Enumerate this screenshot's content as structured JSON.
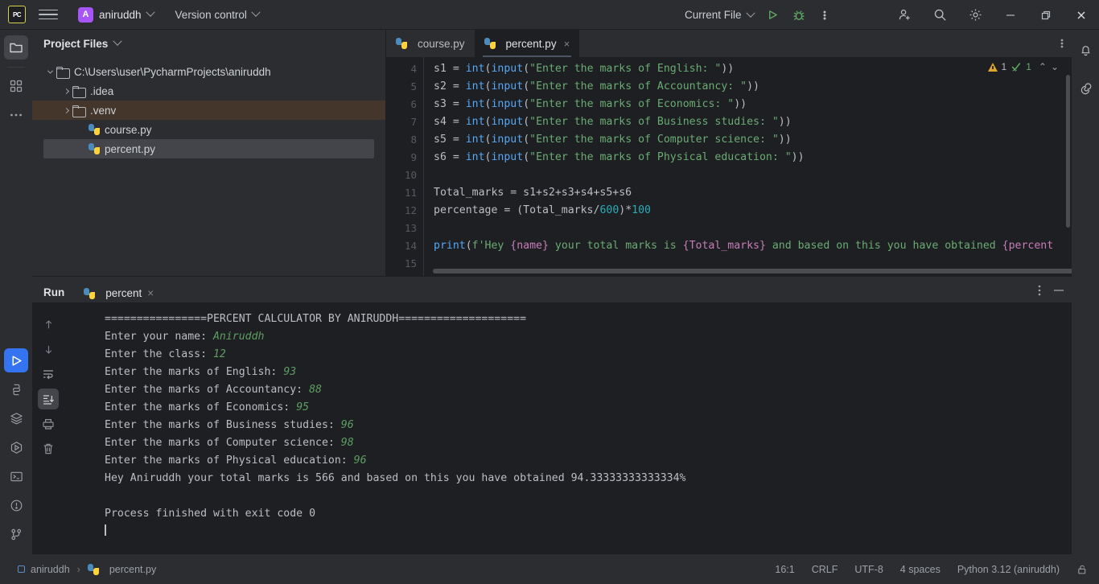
{
  "topbar": {
    "logo": "PC",
    "menu_icon": "hamburger-menu-icon",
    "project_initial": "A",
    "project_name": "aniruddh",
    "version_control": "Version control",
    "run_config": "Current File",
    "run_icon": "run-icon",
    "debug_icon": "debug-icon",
    "more_icon": "more-options-icon",
    "account_icon": "add-user-icon",
    "search_icon": "search-icon",
    "settings_icon": "gear-icon",
    "minimize": "minimize-icon",
    "maximize": "restore-icon",
    "close": "close-icon"
  },
  "left_rail": {
    "items": [
      {
        "name": "project-files-icon",
        "active": true
      },
      {
        "name": "structure-icon",
        "active": false
      },
      {
        "name": "more-tool-windows-icon",
        "active": false
      }
    ],
    "bottom_items": [
      {
        "name": "run-tool-icon",
        "active": true
      },
      {
        "name": "python-packages-icon",
        "active": false
      },
      {
        "name": "database-icon",
        "active": false
      },
      {
        "name": "services-icon",
        "active": false
      },
      {
        "name": "terminal-icon",
        "active": false
      },
      {
        "name": "problems-icon",
        "active": false
      },
      {
        "name": "version-control-icon",
        "active": false
      }
    ]
  },
  "project_panel": {
    "title": "Project Files",
    "tree": [
      {
        "label": "C:\\Users\\user\\PycharmProjects\\aniruddh",
        "type": "folder",
        "indent": 0,
        "expanded": true,
        "state": "none"
      },
      {
        "label": ".idea",
        "type": "folder",
        "indent": 1,
        "expanded": false,
        "state": "none"
      },
      {
        "label": ".venv",
        "type": "folder",
        "indent": 1,
        "expanded": false,
        "state": "orange"
      },
      {
        "label": "course.py",
        "type": "python",
        "indent": 2,
        "expanded": null,
        "state": "none"
      },
      {
        "label": "percent.py",
        "type": "python",
        "indent": 2,
        "expanded": null,
        "state": "grey"
      }
    ]
  },
  "editor": {
    "tabs": [
      {
        "label": "course.py",
        "active": false,
        "closable": false
      },
      {
        "label": "percent.py",
        "active": true,
        "closable": true
      }
    ],
    "close_label": "×",
    "inspections": {
      "warning_count": "1",
      "check_count": "1",
      "up": "⌃",
      "down": "⌄"
    },
    "first_line_number": 4,
    "lines": [
      {
        "n": "4",
        "tokens": [
          {
            "t": "s1 = ",
            "c": "plain"
          },
          {
            "t": "int",
            "c": "fn"
          },
          {
            "t": "(",
            "c": "plain"
          },
          {
            "t": "input",
            "c": "fn"
          },
          {
            "t": "(",
            "c": "plain"
          },
          {
            "t": "\"Enter the marks of English: \"",
            "c": "str"
          },
          {
            "t": "))",
            "c": "plain"
          }
        ]
      },
      {
        "n": "5",
        "tokens": [
          {
            "t": "s2 = ",
            "c": "plain"
          },
          {
            "t": "int",
            "c": "fn"
          },
          {
            "t": "(",
            "c": "plain"
          },
          {
            "t": "input",
            "c": "fn"
          },
          {
            "t": "(",
            "c": "plain"
          },
          {
            "t": "\"Enter the marks of Accountancy: \"",
            "c": "str"
          },
          {
            "t": "))",
            "c": "plain"
          }
        ]
      },
      {
        "n": "6",
        "tokens": [
          {
            "t": "s3 = ",
            "c": "plain"
          },
          {
            "t": "int",
            "c": "fn"
          },
          {
            "t": "(",
            "c": "plain"
          },
          {
            "t": "input",
            "c": "fn"
          },
          {
            "t": "(",
            "c": "plain"
          },
          {
            "t": "\"Enter the marks of Economics: \"",
            "c": "str"
          },
          {
            "t": "))",
            "c": "plain"
          }
        ]
      },
      {
        "n": "7",
        "tokens": [
          {
            "t": "s4 = ",
            "c": "plain"
          },
          {
            "t": "int",
            "c": "fn"
          },
          {
            "t": "(",
            "c": "plain"
          },
          {
            "t": "input",
            "c": "fn"
          },
          {
            "t": "(",
            "c": "plain"
          },
          {
            "t": "\"Enter the marks of Business studies: \"",
            "c": "str"
          },
          {
            "t": "))",
            "c": "plain"
          }
        ]
      },
      {
        "n": "8",
        "tokens": [
          {
            "t": "s5 = ",
            "c": "plain"
          },
          {
            "t": "int",
            "c": "fn"
          },
          {
            "t": "(",
            "c": "plain"
          },
          {
            "t": "input",
            "c": "fn"
          },
          {
            "t": "(",
            "c": "plain"
          },
          {
            "t": "\"Enter the marks of Computer science: \"",
            "c": "str"
          },
          {
            "t": "))",
            "c": "plain"
          }
        ]
      },
      {
        "n": "9",
        "tokens": [
          {
            "t": "s6 = ",
            "c": "plain"
          },
          {
            "t": "int",
            "c": "fn"
          },
          {
            "t": "(",
            "c": "plain"
          },
          {
            "t": "input",
            "c": "fn"
          },
          {
            "t": "(",
            "c": "plain"
          },
          {
            "t": "\"Enter the marks of Physical education: \"",
            "c": "str"
          },
          {
            "t": "))",
            "c": "plain"
          }
        ]
      },
      {
        "n": "10",
        "tokens": []
      },
      {
        "n": "11",
        "tokens": [
          {
            "t": "Total_marks = s1+s2+s3+s4+s5+s6",
            "c": "plain"
          }
        ]
      },
      {
        "n": "12",
        "tokens": [
          {
            "t": "percentage = (Total_marks/",
            "c": "plain"
          },
          {
            "t": "600",
            "c": "num"
          },
          {
            "t": ")*",
            "c": "plain"
          },
          {
            "t": "100",
            "c": "num"
          }
        ]
      },
      {
        "n": "13",
        "tokens": []
      },
      {
        "n": "14",
        "tokens": [
          {
            "t": "print",
            "c": "fn"
          },
          {
            "t": "(",
            "c": "plain"
          },
          {
            "t": "f'Hey ",
            "c": "str"
          },
          {
            "t": "{name}",
            "c": "brace"
          },
          {
            "t": " your total marks is ",
            "c": "str"
          },
          {
            "t": "{Total_marks}",
            "c": "brace"
          },
          {
            "t": " and based on this you have obtained ",
            "c": "str"
          },
          {
            "t": "{percent",
            "c": "brace"
          }
        ]
      },
      {
        "n": "15",
        "tokens": []
      }
    ]
  },
  "right_rail": {
    "items": [
      {
        "name": "notifications-bell-icon"
      },
      {
        "name": "ai-assistant-icon"
      }
    ]
  },
  "run_panel": {
    "title": "Run",
    "tab_label": "percent",
    "tab_close": "×",
    "toolbar": [
      {
        "name": "rerun-icon"
      },
      {
        "name": "stop-icon"
      },
      {
        "name": "more-run-options-icon"
      }
    ],
    "console_rail": [
      {
        "name": "scroll-up-icon",
        "active": false
      },
      {
        "name": "scroll-down-icon",
        "active": false
      },
      {
        "name": "soft-wrap-icon",
        "active": false
      },
      {
        "name": "scroll-to-end-icon",
        "active": true
      },
      {
        "name": "print-icon",
        "active": false
      },
      {
        "name": "clear-all-icon",
        "active": false
      }
    ],
    "header_icons": [
      {
        "name": "run-panel-options-icon"
      },
      {
        "name": "hide-panel-icon"
      }
    ],
    "console_lines": [
      {
        "text": "================PERCENT CALCULATOR BY ANIRUDDH====================",
        "input": ""
      },
      {
        "text": "Enter your name: ",
        "input": "Aniruddh"
      },
      {
        "text": "Enter the class: ",
        "input": "12"
      },
      {
        "text": "Enter the marks of English: ",
        "input": "93"
      },
      {
        "text": "Enter the marks of Accountancy: ",
        "input": "88"
      },
      {
        "text": "Enter the marks of Economics: ",
        "input": "95"
      },
      {
        "text": "Enter the marks of Business studies: ",
        "input": "96"
      },
      {
        "text": "Enter the marks of Computer science: ",
        "input": "98"
      },
      {
        "text": "Enter the marks of Physical education: ",
        "input": "96"
      },
      {
        "text": "Hey Aniruddh your total marks is 566 and based on this you have obtained 94.33333333333334%",
        "input": ""
      },
      {
        "text": "",
        "input": ""
      },
      {
        "text": "Process finished with exit code 0",
        "input": ""
      }
    ]
  },
  "status_bar": {
    "breadcrumb_project": "aniruddh",
    "breadcrumb_sep": "›",
    "breadcrumb_file": "percent.py",
    "caret_position": "16:1",
    "line_separator": "CRLF",
    "encoding": "UTF-8",
    "indent": "4 spaces",
    "interpreter": "Python 3.12 (aniruddh)",
    "lock_icon": "unlocked-padlock-icon"
  },
  "colors": {
    "accent_blue": "#3574f0",
    "panel_bg": "#2b2d30",
    "editor_bg": "#1e1f22",
    "string_green": "#6aab73",
    "avatar_purple": "#a855f7",
    "selection_orange": "#45362b"
  }
}
